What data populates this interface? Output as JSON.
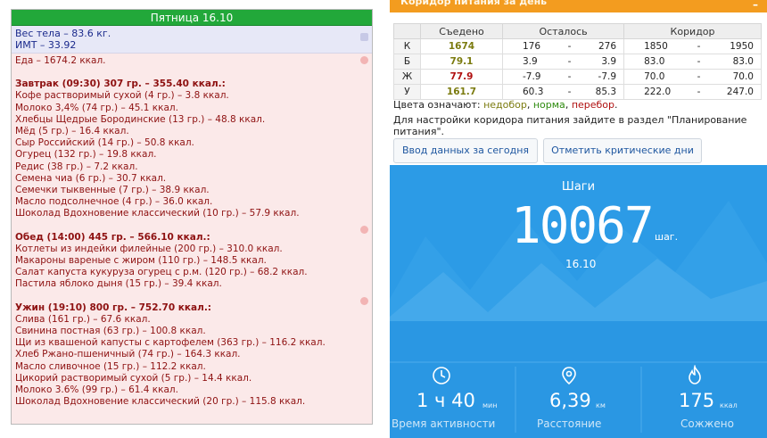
{
  "diary": {
    "day_title": "Пятница 16.10",
    "weight": "Вес тела – 83.6 кг.",
    "bmi": "ИМТ – 33.92",
    "food_total": "Еда – 1674.2 ккал.",
    "meals": [
      {
        "header": "Завтрак (09:30) 307 гр. – 355.40 ккал.:",
        "items": [
          "Кофе растворимый сухой (4 гр.) – 3.8 ккал.",
          "Молоко 3,4% (74 гр.) – 45.1 ккал.",
          "Хлебцы Щедрые Бородинские (13 гр.) – 48.8 ккал.",
          "Мёд (5 гр.) – 16.4 ккал.",
          "Сыр Российский (14 гр.) – 50.8 ккал.",
          "Огурец (132 гр.) – 19.8 ккал.",
          "Редис (38 гр.) – 7.2 ккал.",
          "Семена чиа (6 гр.) – 30.7 ккал.",
          "Семечки тыквенные (7 гр.) – 38.9 ккал.",
          "Масло подсолнечное (4 гр.) – 36.0 ккал.",
          "Шоколад Вдохновение классический (10 гр.) – 57.9 ккал."
        ]
      },
      {
        "header": "Обед (14:00) 445 гр. – 566.10 ккал.:",
        "items": [
          "Котлеты из индейки филейные (200 гр.) – 310.0 ккал.",
          "Макароны вареные с жиром (110 гр.) – 148.5 ккал.",
          "Салат капуста кукуруза огурец с р.м. (120 гр.) – 68.2 ккал.",
          "Пастила яблоко дыня (15 гр.) – 39.4 ккал."
        ]
      },
      {
        "header": "Ужин (19:10) 800 гр. – 752.70 ккал.:",
        "items": [
          "Слива (161 гр.) – 67.6 ккал.",
          "Свинина постная (63 гр.) – 100.8 ккал.",
          "Щи из квашеной капусты с картофелем (363 гр.) – 116.2 ккал.",
          "Хлеб Ржано-пшеничный (74 гр.) – 164.3 ккал.",
          "Масло сливочное (15 гр.) – 112.2 ккал.",
          "Цикорий растворимый сухой (5 гр.) – 14.4 ккал.",
          "Молоко 3.6% (99 гр.) – 61.4 ккал.",
          "Шоколад Вдохновение классический (20 гр.) – 115.8 ккал."
        ]
      }
    ]
  },
  "corridor": {
    "title": "Коридор питания за день",
    "collapse_label": "–",
    "headers": [
      "",
      "Съедено",
      "Осталось",
      "Коридор"
    ],
    "rows": [
      {
        "label": "К",
        "eaten": "1674",
        "eaten_status": "norm",
        "rem_from": "176",
        "dash": "-",
        "rem_to": "276",
        "cor_from": "1850",
        "cor_dash": "-",
        "cor_to": "1950"
      },
      {
        "label": "Б",
        "eaten": "79.1",
        "eaten_status": "under",
        "rem_from": "3.9",
        "dash": "-",
        "rem_to": "3.9",
        "cor_from": "83.0",
        "cor_dash": "-",
        "cor_to": "83.0"
      },
      {
        "label": "Ж",
        "eaten": "77.9",
        "eaten_status": "over",
        "rem_from": "-7.9",
        "dash": "-",
        "rem_to": "-7.9",
        "cor_from": "70.0",
        "cor_dash": "-",
        "cor_to": "70.0"
      },
      {
        "label": "У",
        "eaten": "161.7",
        "eaten_status": "norm",
        "rem_from": "60.3",
        "dash": "-",
        "rem_to": "85.3",
        "cor_from": "222.0",
        "cor_dash": "-",
        "cor_to": "247.0"
      }
    ],
    "legend_prefix": "Цвета означают:",
    "legend_under": "недобор",
    "legend_norm": "норма",
    "legend_over": "перебор",
    "legend_sep": ",",
    "legend_end": ".",
    "note": "Для настройки коридора питания зайдите в раздел \"Планирование питания\".",
    "button_input": "Ввод данных за сегодня",
    "button_critical": "Отметить критические дни",
    "colors": {
      "under": "#7b7b0f",
      "norm": "#2e8b0f",
      "over": "#b01010"
    }
  },
  "steps": {
    "title": "Шаги",
    "count": "10067",
    "unit": "шаг.",
    "date": "16.10",
    "stats": [
      {
        "icon": "clock-icon",
        "value": "1 ч 40",
        "unit": "мин",
        "label": "Время активности"
      },
      {
        "icon": "location-pin-icon",
        "value": "6,39",
        "unit": "км",
        "label": "Расстояние"
      },
      {
        "icon": "flame-icon",
        "value": "175",
        "unit": "ккал",
        "label": "Сожжено"
      }
    ],
    "bg_color": "#2c9be6"
  }
}
